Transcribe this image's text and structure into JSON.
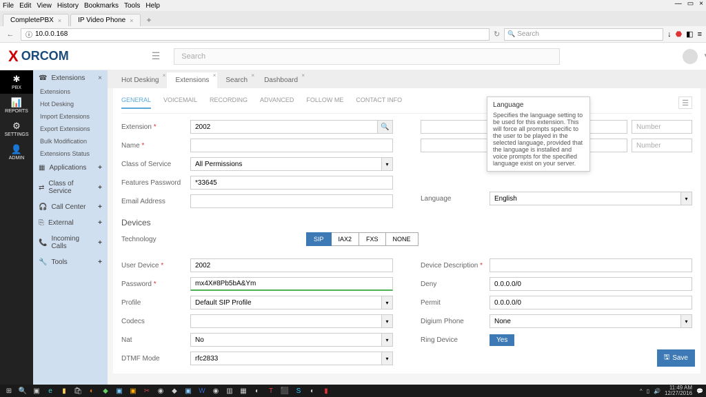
{
  "browser": {
    "menu": [
      "File",
      "Edit",
      "View",
      "History",
      "Bookmarks",
      "Tools",
      "Help"
    ],
    "tabs": [
      {
        "label": "CompletePBX"
      },
      {
        "label": "IP Video Phone"
      }
    ],
    "url_info_icon": "ⓘ",
    "url": "10.0.0.168",
    "refresh": "↻",
    "search_placeholder": "Search",
    "window": {
      "min": "—",
      "max": "▭",
      "close": "×"
    }
  },
  "header": {
    "brand_x": "X",
    "brand_rest": "ORCOM",
    "search_placeholder": "Search"
  },
  "rail": [
    {
      "icon": "✱",
      "label": "PBX",
      "active": true
    },
    {
      "icon": "📊",
      "label": "REPORTS"
    },
    {
      "icon": "⚙",
      "label": "SETTINGS"
    },
    {
      "icon": "👤",
      "label": "ADMIN"
    }
  ],
  "sidebar": {
    "header_icon": "☎",
    "header_label": "Extensions",
    "sub": [
      "Extensions",
      "Hot Desking",
      "Import Extensions",
      "Export Extensions",
      "Bulk Modification",
      "Extensions Status"
    ],
    "groups": [
      {
        "icon": "▦",
        "label": "Applications"
      },
      {
        "icon": "⇄",
        "label": "Class of Service"
      },
      {
        "icon": "🎧",
        "label": "Call Center"
      },
      {
        "icon": "⎘",
        "label": "External"
      },
      {
        "icon": "📞",
        "label": "Incoming Calls"
      },
      {
        "icon": "🔧",
        "label": "Tools"
      }
    ]
  },
  "content_tabs": [
    "Hot Desking",
    "Extensions",
    "Search",
    "Dashboard"
  ],
  "content_tabs_active": 1,
  "sub_tabs": [
    "GENERAL",
    "VOICEMAIL",
    "RECORDING",
    "ADVANCED",
    "FOLLOW ME",
    "CONTACT INFO"
  ],
  "sub_tabs_active": 0,
  "form": {
    "left": {
      "extension_label": "Extension",
      "extension_value": "2002",
      "name_label": "Name",
      "name_value": "",
      "cos_label": "Class of Service",
      "cos_value": "All Permissions",
      "featpw_label": "Features Password",
      "featpw_value": "*33645",
      "email_label": "Email Address",
      "email_value": ""
    },
    "right": {
      "number_placeholder": "Number",
      "language_label": "Language",
      "language_value": "English"
    }
  },
  "tooltip": {
    "title": "Language",
    "body": "Specifies the language setting to be used for this extension. This will force all prompts specific to the user to be played in the selected language, provided that the language is installed and voice prompts for the specified language exist on your server."
  },
  "devices": {
    "title": "Devices",
    "tech_label": "Technology",
    "tech": [
      "SIP",
      "IAX2",
      "FXS",
      "NONE"
    ],
    "tech_active": 0,
    "left": {
      "userdev_label": "User Device",
      "userdev_value": "2002",
      "pwd_label": "Password",
      "pwd_value": "mx4X#8Pb5bA&Ym",
      "profile_label": "Profile",
      "profile_value": "Default SIP Profile",
      "codecs_label": "Codecs",
      "codecs_value": "",
      "nat_label": "Nat",
      "nat_value": "No",
      "dtmf_label": "DTMF Mode",
      "dtmf_value": "rfc2833"
    },
    "right": {
      "desc_label": "Device Description",
      "desc_value": "",
      "deny_label": "Deny",
      "deny_value": "0.0.0.0/0",
      "permit_label": "Permit",
      "permit_value": "0.0.0.0/0",
      "digium_label": "Digium Phone",
      "digium_value": "None",
      "ring_label": "Ring Device",
      "ring_value": "Yes"
    }
  },
  "save_label": "Save",
  "taskbar": {
    "time": "11:49 AM",
    "date": "12/27/2016"
  }
}
